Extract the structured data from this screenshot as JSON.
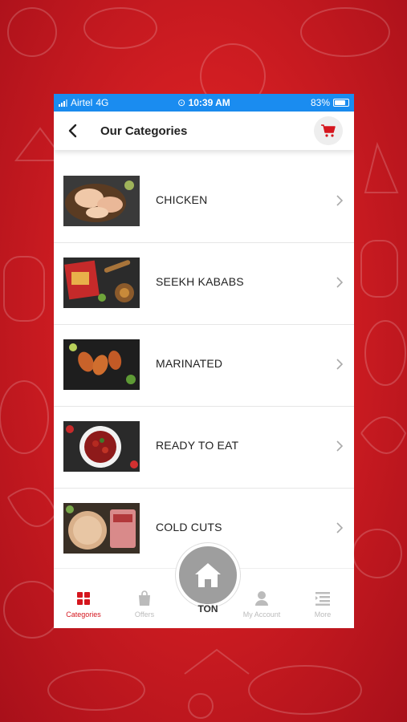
{
  "status_bar": {
    "carrier": "Airtel",
    "network": "4G",
    "time": "10:39 AM",
    "battery": "83%",
    "battery_level": 0.83
  },
  "header": {
    "title": "Our Categories"
  },
  "categories": [
    {
      "label": "CHICKEN"
    },
    {
      "label": "SEEKH KABABS"
    },
    {
      "label": "MARINATED"
    },
    {
      "label": "READY TO EAT"
    },
    {
      "label": "COLD CUTS"
    }
  ],
  "tabbar": {
    "categories": "Categories",
    "offers": "Offers",
    "home_partial": "TON",
    "account": "My Account",
    "more": "More"
  },
  "colors": {
    "brand_red": "#d5161e",
    "status_blue": "#1a8cf0",
    "inactive": "#bbbbbb"
  }
}
